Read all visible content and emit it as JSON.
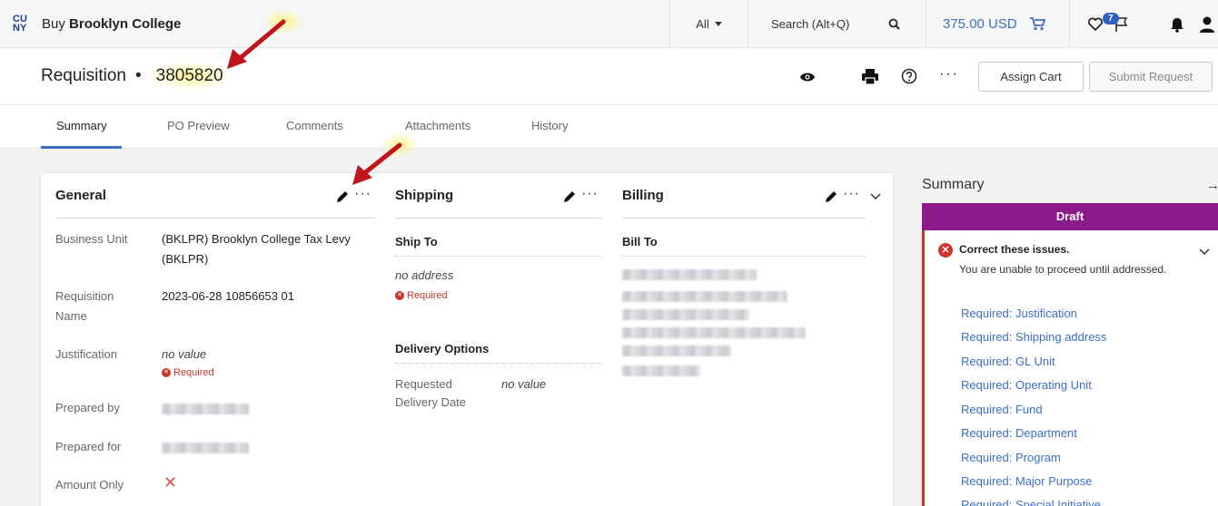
{
  "topbar": {
    "logo": "CU NY",
    "brand_prefix": "Buy",
    "brand_name": "Brooklyn College",
    "scope": "All",
    "search_placeholder": "Search (Alt+Q)",
    "cart_total": "375.00 USD",
    "notification_count": "7"
  },
  "header": {
    "title": "Requisition",
    "separator": "•",
    "number": "3805820",
    "assign_cart": "Assign Cart",
    "submit_request": "Submit Request"
  },
  "tabs": [
    "Summary",
    "PO Preview",
    "Comments",
    "Attachments",
    "History"
  ],
  "general": {
    "title": "General",
    "business_unit_label": "Business Unit",
    "business_unit_value_1": "(BKLPR) Brooklyn College Tax Levy",
    "business_unit_value_2": "(BKLPR)",
    "req_name_label_1": "Requisition",
    "req_name_label_2": "Name",
    "req_name_value": "2023-06-28 10856653 01",
    "justification_label": "Justification",
    "justification_value": "no value",
    "required": "Required",
    "prepared_by_label": "Prepared by",
    "prepared_for_label": "Prepared for",
    "amount_only_label": "Amount Only"
  },
  "shipping": {
    "title": "Shipping",
    "ship_to": "Ship To",
    "no_address": "no address",
    "required": "Required",
    "delivery_options": "Delivery Options",
    "requested_label_1": "Requested",
    "requested_label_2": "Delivery Date",
    "requested_value": "no value"
  },
  "billing": {
    "title": "Billing",
    "bill_to": "Bill To"
  },
  "summary": {
    "title": "Summary",
    "status": "Draft",
    "issues_title": "Correct these issues.",
    "issues_sub": "You are unable to proceed until addressed.",
    "links": [
      "Required: Justification",
      "Required: Shipping address",
      "Required: GL Unit",
      "Required: Operating Unit",
      "Required: Fund",
      "Required: Department",
      "Required: Program",
      "Required: Major Purpose",
      "Required: Special Initiative"
    ]
  },
  "colors": {
    "accent": "#3b6fc6",
    "draft": "#8b1a8b",
    "error": "#c0392b",
    "annotation": "#c0161b"
  }
}
